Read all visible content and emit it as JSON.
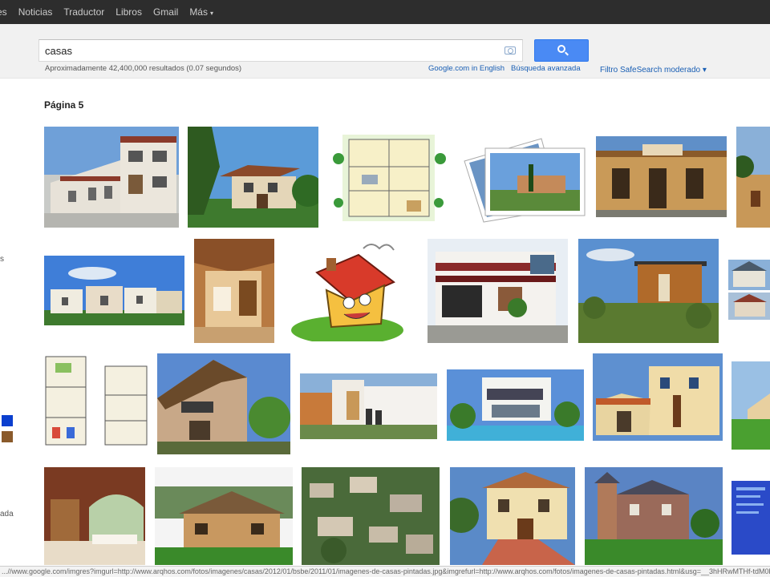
{
  "topnav": {
    "items": [
      "es",
      "Noticias",
      "Traductor",
      "Libros",
      "Gmail",
      "Más"
    ],
    "more_caret": "▾"
  },
  "search": {
    "query": "casas",
    "button_icon": "search-icon",
    "safesearch": "Filtro SafeSearch moderado ▾",
    "stats": "Aproximadamente 42,400,000 resultados (0.07 segundos)",
    "link_english": "Google.com in English",
    "link_advanced": "Búsqueda avanzada"
  },
  "results": {
    "page_label": "Página 5"
  },
  "sidebar": {
    "fragment_1": "s",
    "fragment_2": "ada",
    "swatch_colors": [
      "#0b3fcf",
      "#8a5a2b"
    ]
  },
  "colors": {
    "topbar": "#2d2d2d",
    "search_button": "#4a8af4",
    "link": "#1a5fb4"
  },
  "status_url": "...//www.google.com/imgres?imgurl=http://www.arqhos.com/fotos/imagenes/casas/2012/01/bsbe/2011/01/imagenes-de-casas-pintadas.jpg&imgrefurl=http://www.arqhos.com/fotos/imagenes-de-casas-pintadas.html&usg=__3hHRwMTHf-tdM0bFoF4h6r..."
}
